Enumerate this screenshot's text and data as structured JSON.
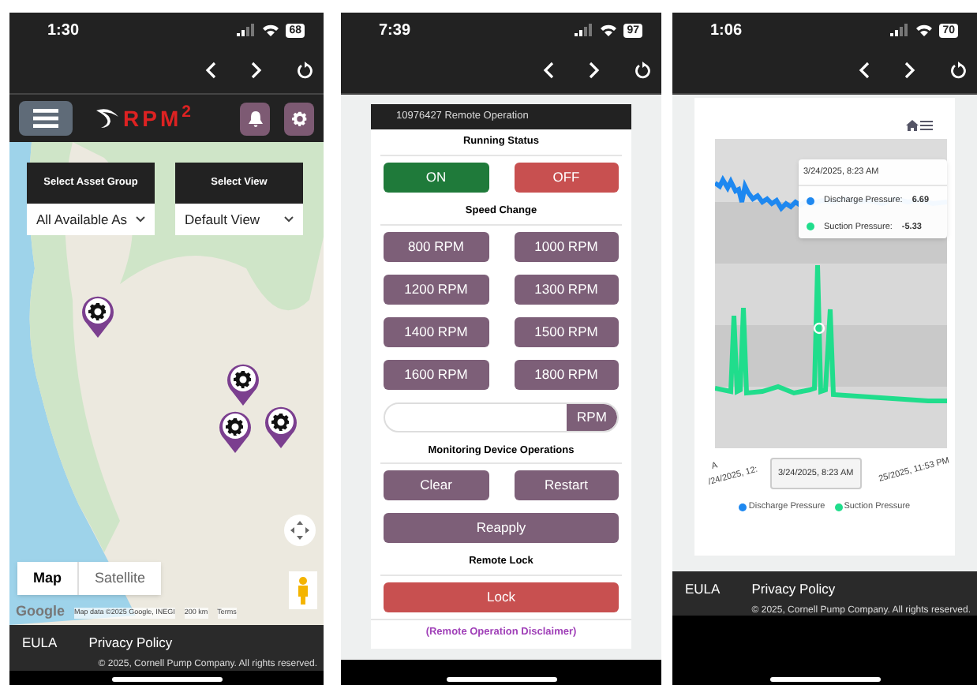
{
  "phones": [
    {
      "kind": "map",
      "status_bar": {
        "time": "1:30",
        "battery": "68"
      },
      "app_bar": {
        "logo": "RPM$^{2}$"
      },
      "selectors": [
        {
          "label": "Select Asset Group",
          "value": "All Available As"
        },
        {
          "label": "Select View",
          "value": "Default View"
        }
      ],
      "map_types": [
        {
          "label": "Map",
          "selected": true
        },
        {
          "label": "Satellite",
          "selected": false
        }
      ],
      "attribution": {
        "logo": "Google",
        "data": "Map data ©2025 Google, INEGI",
        "scale": "200 km",
        "terms": "Terms"
      },
      "footer": {
        "links": [
          "EULA",
          "Privacy Policy"
        ],
        "copyright": "© 2025, Cornell Pump Company. All rights reserved."
      }
    },
    {
      "kind": "remote",
      "status_bar": {
        "time": "7:39",
        "battery": "97"
      },
      "title": "10976427 Remote Operation",
      "sections": [
        {
          "heading": "Running Status",
          "buttons": [
            {
              "label": "ON",
              "kind": "go"
            },
            {
              "label": "OFF",
              "kind": "stop"
            }
          ]
        },
        {
          "heading": "Speed Change",
          "buttons": [
            {
              "label": "800 RPM",
              "kind": "action"
            },
            {
              "label": "1000 RPM",
              "kind": "action"
            },
            {
              "label": "1200 RPM",
              "kind": "action"
            },
            {
              "label": "1300 RPM",
              "kind": "action"
            },
            {
              "label": "1400 RPM",
              "kind": "action"
            },
            {
              "label": "1500 RPM",
              "kind": "action"
            },
            {
              "label": "1600 RPM",
              "kind": "action"
            },
            {
              "label": "1800 RPM",
              "kind": "action"
            }
          ],
          "field_unit": "RPM"
        },
        {
          "heading": "Monitoring Device Operations",
          "buttons": [
            {
              "label": "Clear",
              "kind": "action"
            },
            {
              "label": "Restart",
              "kind": "action"
            },
            {
              "label": "Reapply",
              "kind": "action-wide"
            }
          ]
        },
        {
          "heading": "Remote Lock",
          "buttons": [
            {
              "label": "Lock",
              "kind": "stop-wide"
            }
          ]
        }
      ],
      "disclaimer": "(Remote Operation Disclaimer)"
    },
    {
      "kind": "chart",
      "status_bar": {
        "time": "1:06",
        "battery": "70"
      },
      "tooltip": {
        "title": "3/24/2025, 8:23 AM",
        "rows": [
          {
            "name": "Discharge Pressure:",
            "value": "6.69",
            "color": "#1e88f0"
          },
          {
            "name": "Suction Pressure:",
            "value": "-5.33",
            "color": "#20dd8c"
          }
        ]
      },
      "x_labels": [
        "A",
        "/24/2025, 12:",
        "25/2025, 11:53 PM"
      ],
      "crosshair_label": "3/24/2025, 8:23 AM",
      "legend": [
        {
          "name": "Discharge Pressure",
          "color": "#1e88f0"
        },
        {
          "name": "Suction Pressure",
          "color": "#20dd8c"
        }
      ],
      "footer": {
        "links": [
          "EULA",
          "Privacy Policy"
        ],
        "copyright": "© 2025, Cornell Pump Company. All rights reserved."
      }
    }
  ]
}
